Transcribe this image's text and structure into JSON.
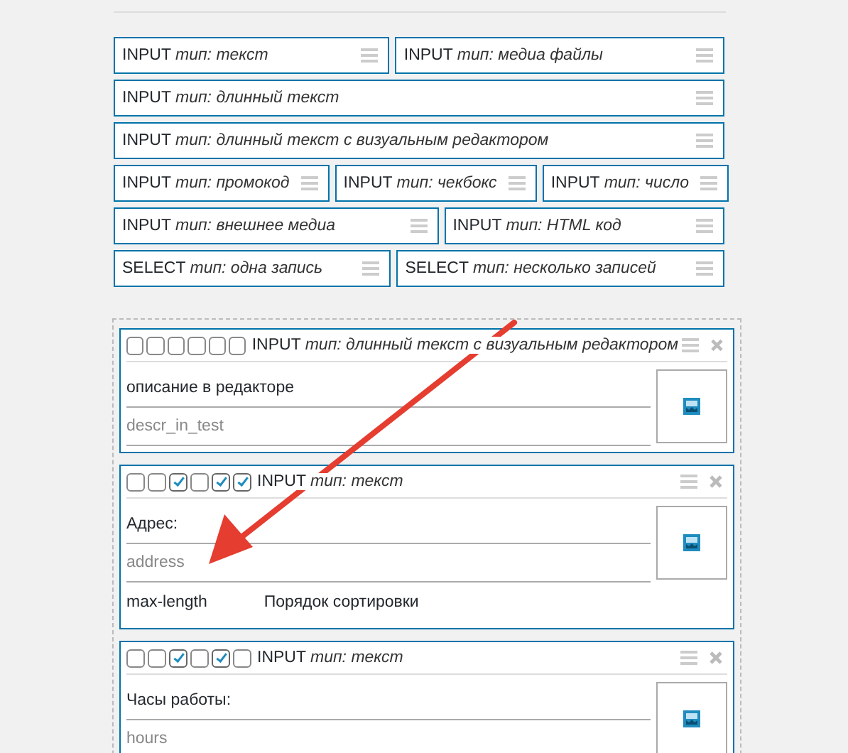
{
  "palette": [
    [
      {
        "type": "INPUT",
        "subtype": "тип: текст"
      },
      {
        "type": "INPUT",
        "subtype": "тип: медиа файлы"
      }
    ],
    [
      {
        "type": "INPUT",
        "subtype": "тип: длинный текст"
      }
    ],
    [
      {
        "type": "INPUT",
        "subtype": "тип: длинный текст с визуальным редактором"
      }
    ],
    [
      {
        "type": "INPUT",
        "subtype": "тип: промокод"
      },
      {
        "type": "INPUT",
        "subtype": "тип: чекбокс"
      },
      {
        "type": "INPUT",
        "subtype": "тип: число"
      }
    ],
    [
      {
        "type": "INPUT",
        "subtype": "тип: внешнее медиа"
      },
      {
        "type": "INPUT",
        "subtype": "тип: HTML код"
      }
    ],
    [
      {
        "type": "SELECT",
        "subtype": "тип: одна запись"
      },
      {
        "type": "SELECT",
        "subtype": "тип: несколько записей"
      }
    ]
  ],
  "fields": [
    {
      "checks": [
        false,
        false,
        false,
        false,
        false,
        false
      ],
      "type": "INPUT",
      "subtype": "тип: длинный текст с визуальным редактором",
      "label": "описание в редакторе",
      "name": "descr_in_test"
    },
    {
      "checks": [
        false,
        false,
        true,
        false,
        true,
        true
      ],
      "type": "INPUT",
      "subtype": "тип: текст",
      "label": "Адрес:",
      "name": "address",
      "extras": [
        "max-length",
        "Порядок сортировки"
      ]
    },
    {
      "checks": [
        false,
        false,
        true,
        false,
        true,
        false
      ],
      "type": "INPUT",
      "subtype": "тип: текст",
      "label": "Часы работы:",
      "name": "hours"
    }
  ]
}
